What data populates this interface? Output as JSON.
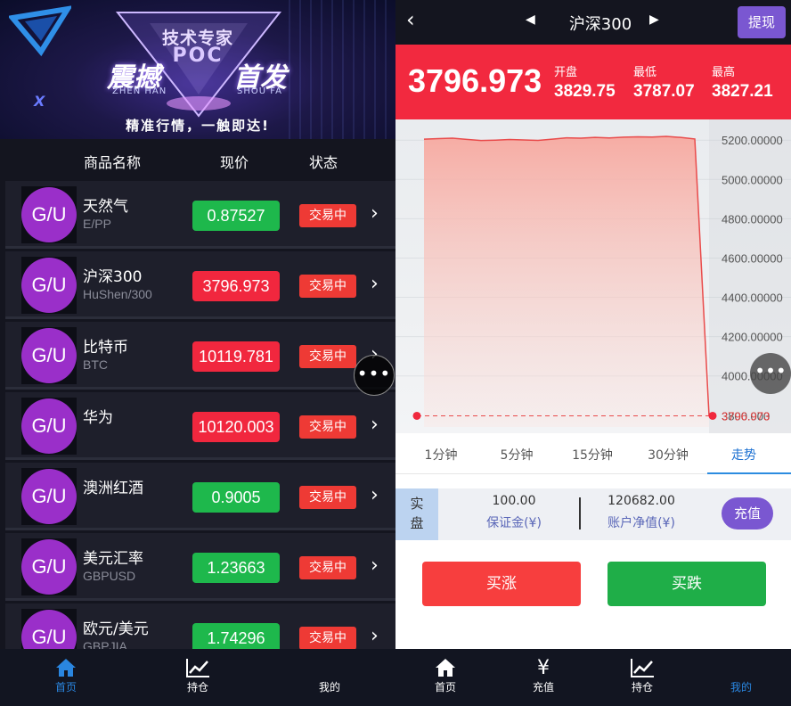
{
  "banner": {
    "top_title": "技术专家",
    "poc": "POC",
    "left_title": "震撼",
    "left_pinyin": "ZHEN HAN",
    "right_title": "首发",
    "right_pinyin": "SHOU FA",
    "slogan": "精准行情，一触即达!",
    "x_mark": "X"
  },
  "list_header": {
    "name": "商品名称",
    "price": "现价",
    "status": "状态"
  },
  "products": [
    {
      "avatar": "G/U",
      "name": "天然气",
      "code": "E/PP",
      "price": "0.87527",
      "direction": "up",
      "status": "交易中"
    },
    {
      "avatar": "G/U",
      "name": "沪深300",
      "code": "HuShen/300",
      "price": "3796.973",
      "direction": "down",
      "status": "交易中"
    },
    {
      "avatar": "G/U",
      "name": "比特币",
      "code": "BTC",
      "price": "10119.781",
      "direction": "down",
      "status": "交易中"
    },
    {
      "avatar": "G/U",
      "name": "华为",
      "code": "",
      "price": "10120.003",
      "direction": "down",
      "status": "交易中"
    },
    {
      "avatar": "G/U",
      "name": "澳洲红酒",
      "code": "",
      "price": "0.9005",
      "direction": "up",
      "status": "交易中"
    },
    {
      "avatar": "G/U",
      "name": "美元汇率",
      "code": "GBPUSD",
      "price": "1.23663",
      "direction": "up",
      "status": "交易中"
    },
    {
      "avatar": "G/U",
      "name": "欧元/美元",
      "code": "GBPJIA",
      "price": "1.74296",
      "direction": "up",
      "status": "交易中"
    }
  ],
  "tabbar_left": {
    "home": "首页",
    "holdings": "持仓",
    "mine": "我的"
  },
  "detail": {
    "back": "‹",
    "prev": "◀",
    "title": "沪深300",
    "next": "▶",
    "withdraw": "提现",
    "current": "3796.973",
    "open_label": "开盘",
    "open_value": "3829.75",
    "low_label": "最低",
    "low_value": "3787.07",
    "high_label": "最高",
    "high_value": "3827.21"
  },
  "periods": [
    "1分钟",
    "5分钟",
    "15分钟",
    "30分钟",
    "走势"
  ],
  "active_period": 4,
  "account": {
    "tag_line1": "实",
    "tag_line2": "盘",
    "margin_value": "100.00",
    "margin_label": "保证金(¥)",
    "equity_value": "120682.00",
    "equity_label": "账户净值(¥)",
    "recharge": "充值"
  },
  "actions": {
    "buy_up": "买涨",
    "buy_down": "买跌"
  },
  "tabbar_right": {
    "home": "首页",
    "recharge": "充值",
    "holdings": "持仓",
    "mine": "我的"
  },
  "colors": {
    "up": "#1eb84c",
    "down": "#f1273e",
    "accent": "#7a57d1",
    "active_tab": "#2c8ce0"
  },
  "chart_data": {
    "type": "area",
    "y_tick_labels": [
      "5200.00000",
      "5000.00000",
      "4800.00000",
      "4600.00000",
      "4400.00000",
      "4200.00000",
      "4000.00000",
      "3800.000"
    ],
    "y_ticks": [
      5200,
      5000,
      4800,
      4600,
      4400,
      4200,
      4000
    ],
    "ylim": [
      3740,
      5260
    ],
    "x": [
      0,
      1,
      2,
      3,
      4,
      5,
      6,
      7,
      8,
      9,
      10,
      11,
      12,
      13,
      14,
      15,
      16,
      17,
      18,
      19,
      20
    ],
    "values": [
      5205,
      5208,
      5210,
      5204,
      5198,
      5200,
      5203,
      5201,
      5199,
      5205,
      5212,
      5210,
      5214,
      5211,
      5215,
      5217,
      5216,
      5219,
      5214,
      5206,
      3797
    ],
    "reference_value": 3797,
    "reference_label": "3796.973",
    "series_color": "#e94b4b"
  }
}
